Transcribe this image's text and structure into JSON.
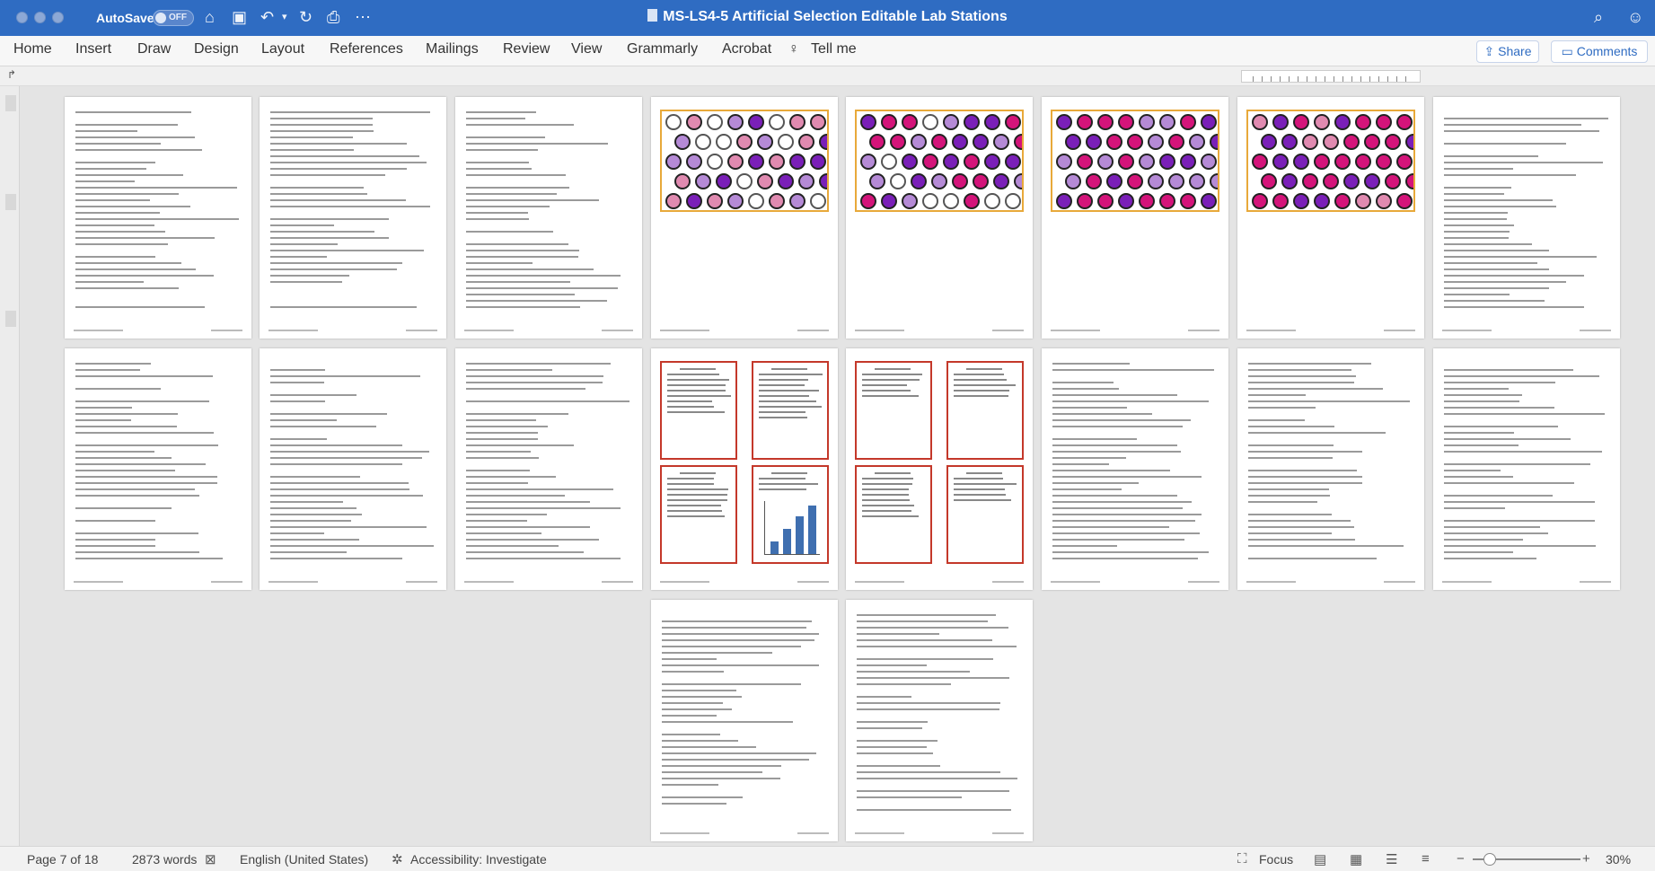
{
  "titlebar": {
    "autosave_label": "AutoSave",
    "autosave_state": "OFF",
    "document_title": "MS-LS4-5 Artificial Selection Editable Lab Stations",
    "icons": [
      "home-icon",
      "save-icon",
      "undo-icon",
      "redo-icon",
      "print-icon",
      "more-icon",
      "search-icon",
      "user-icon"
    ]
  },
  "ribbon": {
    "tabs": [
      "Home",
      "Insert",
      "Draw",
      "Design",
      "Layout",
      "References",
      "Mailings",
      "Review",
      "View",
      "Grammarly",
      "Acrobat"
    ],
    "tell_me": "Tell me",
    "share": "Share",
    "comments": "Comments"
  },
  "statusbar": {
    "page": "Page 7 of 18",
    "words": "2873 words",
    "language": "English (United States)",
    "accessibility": "Accessibility: Investigate",
    "focus": "Focus",
    "zoom": "30%"
  },
  "colors": {
    "title_bar": "#2f6cc2",
    "flower_purple": "#7a1fb8",
    "flower_magenta": "#d4147a",
    "flower_lavender": "#b58ad6",
    "flower_pink": "#e08ab0",
    "card_border": "#c4382a",
    "photo_border": "#e8a93a"
  }
}
